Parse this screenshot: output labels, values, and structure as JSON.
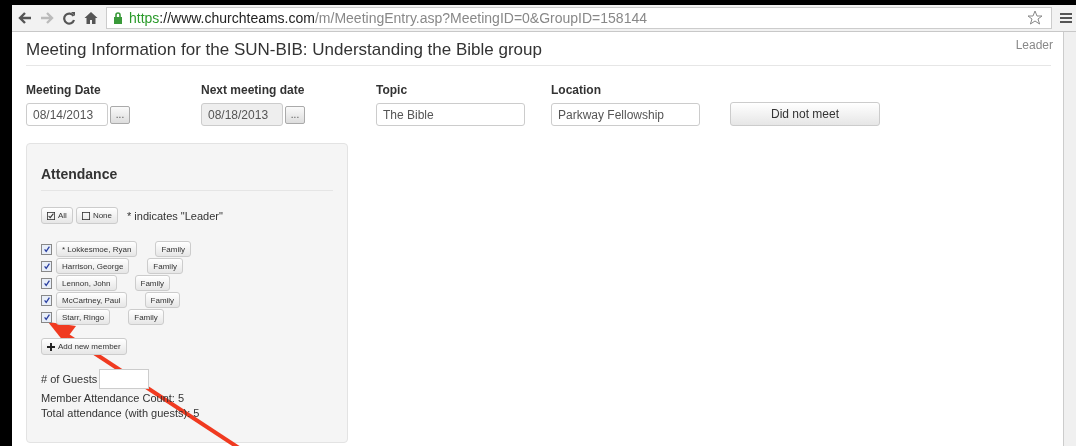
{
  "browser": {
    "url": {
      "scheme": "https",
      "host": "://www.churchteams.com",
      "path": "/m/MeetingEntry.asp?MeetingID=0&GroupID=158144"
    }
  },
  "page": {
    "title": "Meeting Information for the SUN-BIB: Understanding the Bible group",
    "role": "Leader"
  },
  "fields": [
    {
      "label": "Meeting Date",
      "value": "08/14/2013",
      "disabled": false,
      "kind": "date",
      "picker": "..."
    },
    {
      "label": "Next meeting date",
      "value": "08/18/2013",
      "disabled": true,
      "kind": "date",
      "picker": "..."
    },
    {
      "label": "Topic",
      "value": "The Bible",
      "disabled": false,
      "kind": "text"
    },
    {
      "label": "Location",
      "value": "Parkway Fellowship",
      "disabled": false,
      "kind": "text"
    }
  ],
  "did_not_meet": "Did not meet",
  "attendance": {
    "title": "Attendance",
    "all": "All",
    "none": "None",
    "note": "* indicates \"Leader\"",
    "members": [
      {
        "name": "* Lokkesmoe, Ryan",
        "family": "Family",
        "checked": true
      },
      {
        "name": "Harrison, George",
        "family": "Family",
        "checked": true
      },
      {
        "name": "Lennon, John",
        "family": "Family",
        "checked": true
      },
      {
        "name": "McCartney, Paul",
        "family": "Family",
        "checked": true
      },
      {
        "name": "Starr, Ringo",
        "family": "Family",
        "checked": true
      }
    ],
    "add_member": "Add new member",
    "guests_label": "# of Guests",
    "member_count": "Member Attendance Count: 5",
    "total": "Total attendance (with guests): 5"
  }
}
